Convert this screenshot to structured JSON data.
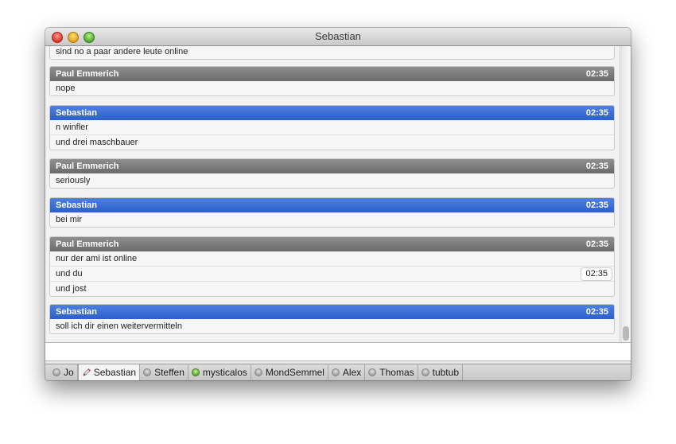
{
  "window": {
    "title": "Sebastian"
  },
  "transcript": {
    "top_partial_line": "sind no a paar andere leute online",
    "blocks": [
      {
        "sender": "Paul Emmerich",
        "time": "02:35",
        "kind": "gray",
        "lines": [
          "nope"
        ]
      },
      {
        "sender": "Sebastian",
        "time": "02:35",
        "kind": "blue",
        "lines": [
          "n winfler",
          "und drei maschbauer"
        ]
      },
      {
        "sender": "Paul Emmerich",
        "time": "02:35",
        "kind": "gray",
        "lines": [
          "seriously"
        ]
      },
      {
        "sender": "Sebastian",
        "time": "02:35",
        "kind": "blue",
        "lines": [
          "bei mir"
        ]
      },
      {
        "sender": "Paul Emmerich",
        "time": "02:35",
        "kind": "gray",
        "lines": [
          "nur der ami ist online",
          "und du",
          "und jost"
        ],
        "hover_time": "02:35"
      },
      {
        "sender": "Sebastian",
        "time": "02:35",
        "kind": "blue",
        "lines": [
          "soll ich dir einen weitervermitteln"
        ]
      }
    ]
  },
  "input": {
    "value": ""
  },
  "tabs": [
    {
      "label": "Jo",
      "status": "gray"
    },
    {
      "label": "Sebastian",
      "status": "typing",
      "active": true
    },
    {
      "label": "Steffen",
      "status": "gray"
    },
    {
      "label": "mysticalos",
      "status": "green"
    },
    {
      "label": "MondSemmel",
      "status": "gray"
    },
    {
      "label": "Alex",
      "status": "gray"
    },
    {
      "label": "Thomas",
      "status": "gray"
    },
    {
      "label": "tubtub",
      "status": "gray"
    }
  ],
  "colors": {
    "header_gray": "#6f6f6f",
    "header_blue": "#2f63cf",
    "status_green": "#4ea42a"
  }
}
